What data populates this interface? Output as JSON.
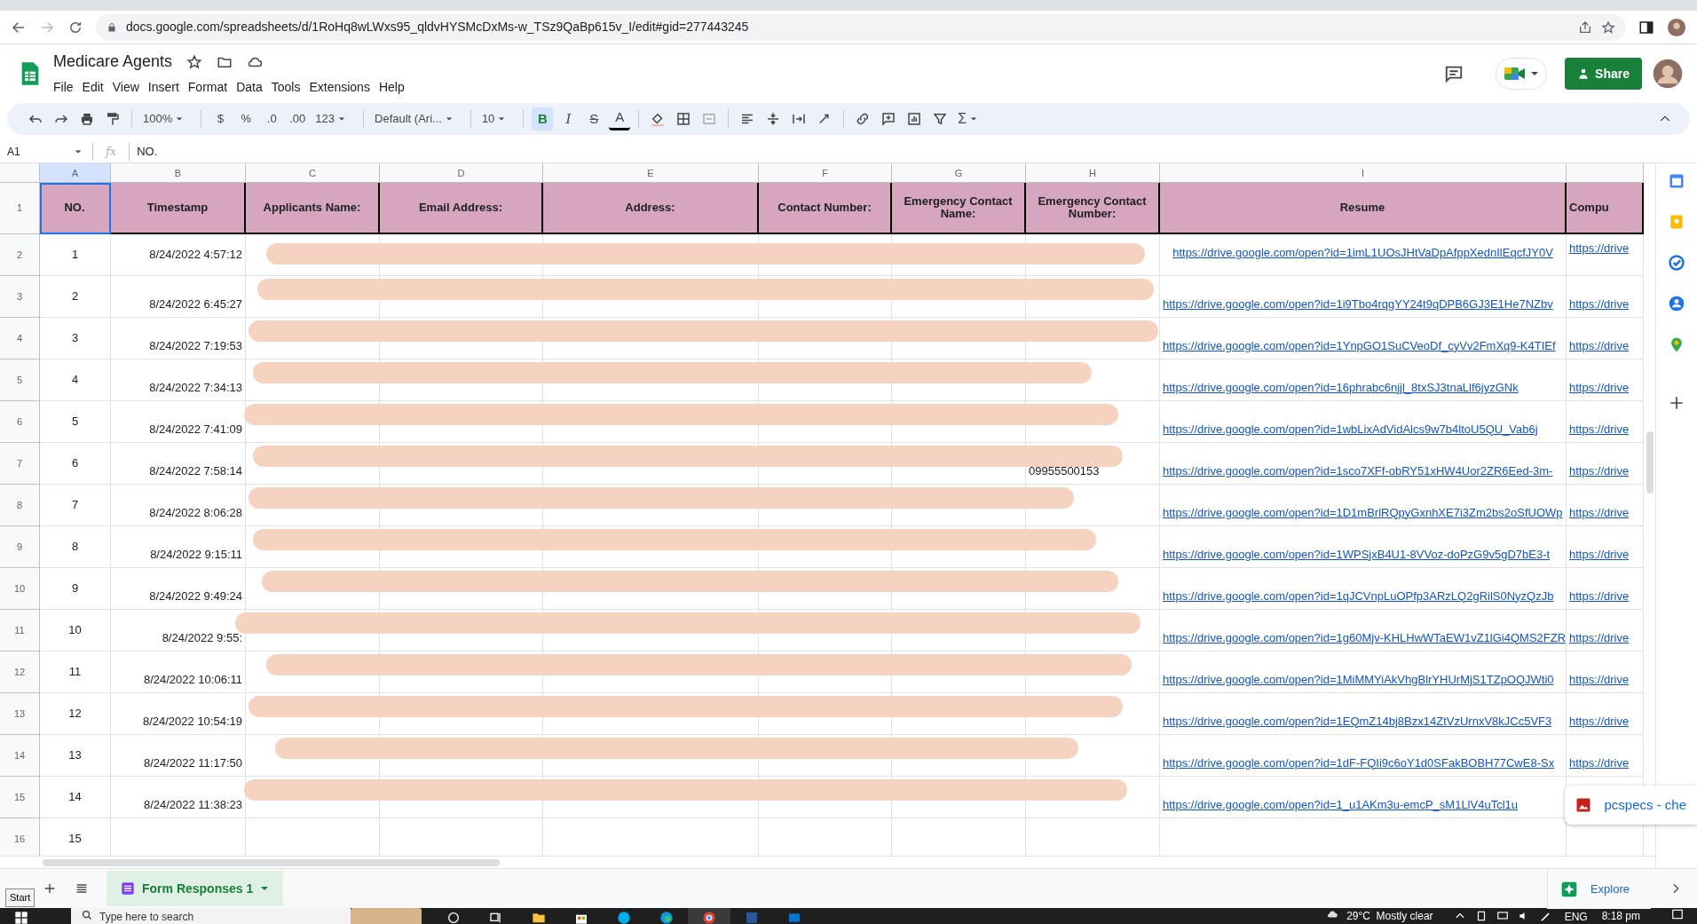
{
  "browser": {
    "url": "docs.google.com/spreadsheets/d/1RoHq8wLWxs95_qldvHYSMcDxMs-w_TSz9QaBp615v_I/edit#gid=277443245"
  },
  "doc": {
    "title": "Medicare Agents",
    "menu": [
      "File",
      "Edit",
      "View",
      "Insert",
      "Format",
      "Data",
      "Tools",
      "Extensions",
      "Help"
    ],
    "share": "Share"
  },
  "toolbar": [
    {
      "kind": "undo"
    },
    {
      "kind": "redo"
    },
    {
      "kind": "print"
    },
    {
      "kind": "paint"
    },
    {
      "kind": "sep"
    },
    {
      "kind": "drop",
      "label": "100%"
    },
    {
      "kind": "sep"
    },
    {
      "kind": "text",
      "label": "$"
    },
    {
      "kind": "text",
      "label": "%"
    },
    {
      "kind": "text",
      "label": ".0"
    },
    {
      "kind": "text",
      "label": ".00"
    },
    {
      "kind": "drop",
      "label": "123"
    },
    {
      "kind": "sep"
    },
    {
      "kind": "drop",
      "label": "Default (Ari..."
    },
    {
      "kind": "sep"
    },
    {
      "kind": "drop",
      "label": "10"
    },
    {
      "kind": "sep"
    },
    {
      "kind": "toggle",
      "label": "B",
      "selected": true
    },
    {
      "kind": "toggle",
      "label": "I",
      "selected": false
    },
    {
      "kind": "toggle",
      "label": "S",
      "selected": false
    },
    {
      "kind": "textcolor",
      "label": "A"
    },
    {
      "kind": "sep"
    },
    {
      "kind": "fill"
    },
    {
      "kind": "borders"
    },
    {
      "kind": "merge"
    },
    {
      "kind": "sep"
    },
    {
      "kind": "align"
    },
    {
      "kind": "valign"
    },
    {
      "kind": "wrap"
    },
    {
      "kind": "rotate"
    },
    {
      "kind": "sep"
    },
    {
      "kind": "link"
    },
    {
      "kind": "comment"
    },
    {
      "kind": "chart"
    },
    {
      "kind": "filter"
    },
    {
      "kind": "sum",
      "label": "Σ"
    }
  ],
  "formula_bar": {
    "cell": "A1",
    "fx": "fx",
    "value": "NO."
  },
  "sheet": {
    "column_letters": [
      "A",
      "B",
      "C",
      "D",
      "E",
      "F",
      "G",
      "H",
      "I"
    ],
    "header_row": "1",
    "headers": [
      "NO.",
      "Timestamp",
      "Applicants Name:",
      "Email Address:",
      "Address:",
      "Contact Number:",
      "Emergency Contact Name:",
      "Emergency Contact Number:",
      "Resume",
      "Compu"
    ],
    "rows": [
      {
        "row_number": "2",
        "no": "1",
        "timestamp": "8/24/2022 4:57:12",
        "resume": "https://drive.google.com/open?id=1imL1UOsJHtVaDpAfppXednIlEqcfJY0V",
        "column_10": "https://drive",
        "redacted": true
      },
      {
        "row_number": "3",
        "no": "2",
        "timestamp": "8/24/2022 6:45:27",
        "resume": "https://drive.google.com/open?id=1i9Tbo4rqgYY24t9qDPB6GJ3E1He7NZbv",
        "column_10": "https://drive",
        "redacted": true
      },
      {
        "row_number": "4",
        "no": "3",
        "timestamp": "8/24/2022 7:19:53",
        "resume": "https://drive.google.com/open?id=1YnpGO1SuCVeoDf_cyVv2FmXq9-K4TIEf",
        "column_10": "https://drive",
        "redacted": true
      },
      {
        "row_number": "5",
        "no": "4",
        "timestamp": "8/24/2022 7:34:13",
        "resume": "https://drive.google.com/open?id=16phrabc6njjl_8txSJ3tnaLlf6jyzGNk",
        "column_10": "https://drive",
        "redacted": true
      },
      {
        "row_number": "6",
        "no": "5",
        "timestamp": "8/24/2022 7:41:09",
        "resume": "https://drive.google.com/open?id=1wbLixAdVidAlcs9w7b4ltoU5QU_Vab6j",
        "column_10": "https://drive",
        "redacted": true
      },
      {
        "row_number": "7",
        "no": "6",
        "timestamp": "8/24/2022 7:58:14",
        "emergency_contact_number": "09955500153",
        "resume": "https://drive.google.com/open?id=1sco7XFf-obRY51xHW4Uor2ZR6Eed-3m-",
        "column_10": "https://drive",
        "redacted": true
      },
      {
        "row_number": "8",
        "no": "7",
        "timestamp": "8/24/2022 8:06:28",
        "resume": "https://drive.google.com/open?id=1D1mBrlRQpyGxnhXE7i3Zm2bs2oSfUOWp",
        "column_10": "https://drive",
        "redacted": true
      },
      {
        "row_number": "9",
        "no": "8",
        "timestamp": "8/24/2022 9:15:11",
        "resume": "https://drive.google.com/open?id=1WPSjxB4U1-8VVoz-doPzG9v5gD7bE3-t",
        "column_10": "https://drive",
        "redacted": true
      },
      {
        "row_number": "10",
        "no": "9",
        "timestamp": "8/24/2022 9:49:24",
        "resume": "https://drive.google.com/open?id=1qJCVnpLuOPfp3ARzLQ2gRilS0NyzQzJb",
        "column_10": "https://drive",
        "redacted": true
      },
      {
        "row_number": "11",
        "no": "10",
        "timestamp": "8/24/2022 9:55:",
        "resume": "https://drive.google.com/open?id=1g60Mjv-KHLHwWTaEW1vZ1lGi4QMS2FZR",
        "column_10": "https://drive",
        "redacted": true
      },
      {
        "row_number": "12",
        "no": "11",
        "timestamp": "8/24/2022 10:06:11",
        "resume": "https://drive.google.com/open?id=1MiMMYiAkVhgBlrYHUrMjS1TZpOQJWti0",
        "column_10": "https://drive",
        "redacted": true
      },
      {
        "row_number": "13",
        "no": "12",
        "timestamp": "8/24/2022 10:54:19",
        "resume": "https://drive.google.com/open?id=1EQmZ14bj8Bzx14ZtVzUrnxV8kJCc5VF3",
        "column_10": "https://drive",
        "redacted": true
      },
      {
        "row_number": "14",
        "no": "13",
        "timestamp": "8/24/2022 11:17:50",
        "resume": "https://drive.google.com/open?id=1dF-FQIi9c6oY1d0SFakBOBH77CwE8-Sx",
        "column_10": "https://drive",
        "redacted": true
      },
      {
        "row_number": "15",
        "no": "14",
        "timestamp": "8/24/2022 11:38:23",
        "resume": "https://drive.google.com/open?id=1_u1AKm3u-emcP_sM1LlV4uTcl1u",
        "redacted": true
      },
      {
        "row_number": "16",
        "no": "15",
        "redacted": false
      }
    ]
  },
  "sheet_tabs": [
    {
      "label": "Form Responses 1",
      "selected": true
    }
  ],
  "explore": "Explore",
  "notification": "pcspecs - che",
  "tooltip": "Start",
  "taskbar": {
    "search_placeholder": "Type here to search",
    "weather": "29°C  Mostly clear",
    "language": "ENG",
    "time": "8:18 pm"
  }
}
